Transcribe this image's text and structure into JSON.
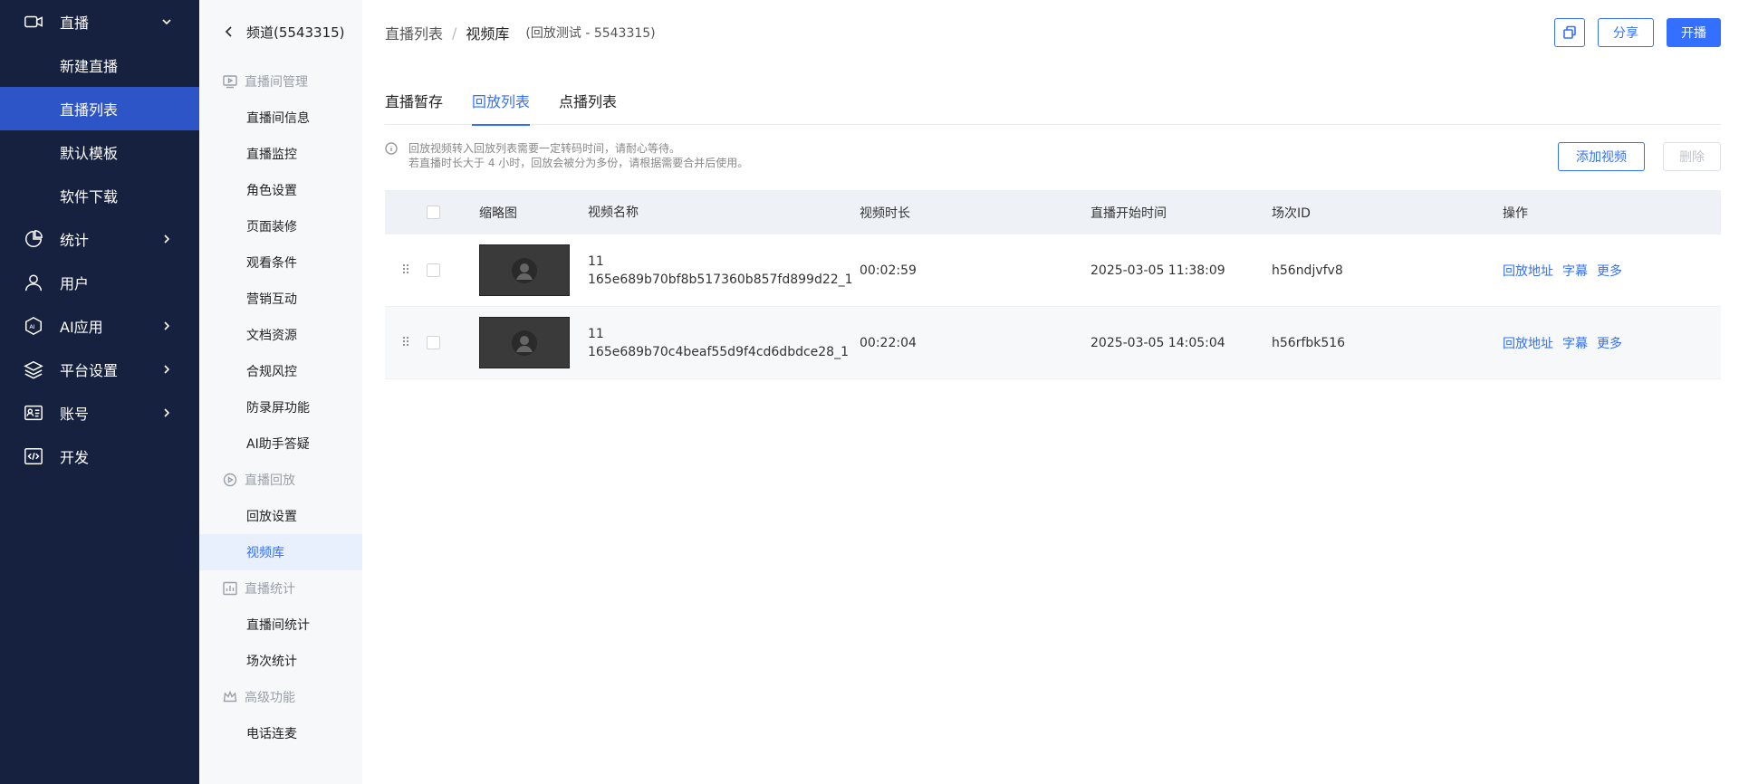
{
  "sidebar": {
    "items": [
      {
        "label": "直播",
        "icon": "video-camera-icon",
        "expanded": true
      },
      {
        "label": "新建直播"
      },
      {
        "label": "直播列表",
        "active": true
      },
      {
        "label": "默认模板"
      },
      {
        "label": "软件下载"
      },
      {
        "label": "统计",
        "icon": "pie-chart-icon"
      },
      {
        "label": "用户",
        "icon": "user-icon"
      },
      {
        "label": "AI应用",
        "icon": "ai-icon"
      },
      {
        "label": "平台设置",
        "icon": "layers-icon"
      },
      {
        "label": "账号",
        "icon": "id-card-icon"
      },
      {
        "label": "开发",
        "icon": "code-icon"
      }
    ]
  },
  "subnav": {
    "header": "频道(5543315)",
    "groups": [
      {
        "title": "直播间管理",
        "icon": "play-screen-icon",
        "items": [
          "直播间信息",
          "直播监控",
          "角色设置",
          "页面装修",
          "观看条件",
          "营销互动",
          "文档资源",
          "合规风控",
          "防录屏功能",
          "AI助手答疑"
        ]
      },
      {
        "title": "直播回放",
        "icon": "replay-icon",
        "items": [
          "回放设置",
          "视频库"
        ]
      },
      {
        "title": "直播统计",
        "icon": "bar-chart-icon",
        "items": [
          "直播间统计",
          "场次统计"
        ]
      },
      {
        "title": "高级功能",
        "icon": "crown-icon",
        "items": [
          "电话连麦"
        ]
      }
    ],
    "active_item": "视频库"
  },
  "breadcrumb": {
    "root": "直播列表",
    "separator": "/",
    "current": "视频库",
    "sub": "(回放测试 - 5543315)"
  },
  "top_actions": {
    "copy_icon": "copy-icon",
    "share": "分享",
    "start": "开播"
  },
  "tabs": [
    "直播暂存",
    "回放列表",
    "点播列表"
  ],
  "active_tab": 1,
  "notice": {
    "line1": "回放视频转入回放列表需要一定转码时间，请耐心等待。",
    "line2": "若直播时长大于 4 小时，回放会被分为多份，请根据需要合并后使用。"
  },
  "list_actions": {
    "add": "添加视频",
    "delete": "删除"
  },
  "table": {
    "headers": [
      "缩略图",
      "视频名称",
      "视频时长",
      "直播开始时间",
      "场次ID",
      "操作"
    ],
    "rows": [
      {
        "name_line1": "11",
        "name_line2": "165e689b70bf8b517360b857fd899d22_1",
        "duration": "00:02:59",
        "start": "2025-03-05 11:38:09",
        "session_id": "h56ndjvfv8",
        "ops": [
          "回放地址",
          "字幕",
          "更多"
        ]
      },
      {
        "name_line1": "11",
        "name_line2": "165e689b70c4beaf55d9f4cd6dbdce28_1",
        "duration": "00:22:04",
        "start": "2025-03-05 14:05:04",
        "session_id": "h56rfbk516",
        "ops": [
          "回放地址",
          "字幕",
          "更多"
        ]
      }
    ]
  },
  "colors": {
    "sidebar_bg": "#16213f",
    "sidebar_active": "#2d55c8",
    "accent": "#3370ff",
    "subnav_bg": "#f7f8fa",
    "table_header_bg": "#eef1f6"
  }
}
